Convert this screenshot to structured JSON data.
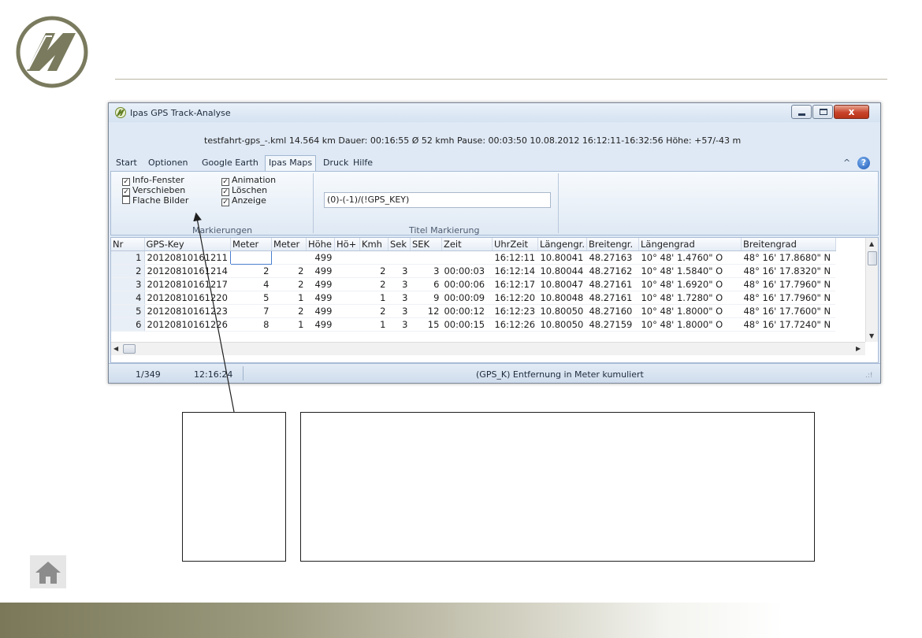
{
  "window": {
    "title": "Ipas GPS Track-Analyse",
    "close_label": "x"
  },
  "info_line": "testfahrt-gps_-.kml 14.564 km  Dauer: 00:16:55  Ø 52 kmh  Pause: 00:03:50  10.08.2012 16:12:11-16:32:56   Höhe: +57/-43 m",
  "ribbon_tabs": [
    "Start",
    "Optionen",
    "Google Earth",
    "Ipas Maps",
    "Druck",
    "Hilfe"
  ],
  "help_label": "?",
  "collapse_label": "^",
  "markierungen": {
    "group_label": "Markierungen",
    "checkboxes": [
      {
        "label": "Info-Fenster",
        "checked": true
      },
      {
        "label": "Verschieben",
        "checked": true
      },
      {
        "label": "Flache Bilder",
        "checked": false
      },
      {
        "label": "Animation",
        "checked": true
      },
      {
        "label": "Löschen",
        "checked": true
      },
      {
        "label": "Anzeige",
        "checked": true
      }
    ]
  },
  "titel_markierung": {
    "group_label": "Titel Markierung",
    "value": "(0)-(-1)/(!GPS_KEY)"
  },
  "grid": {
    "columns": [
      "Nr",
      "GPS-Key",
      "Meter",
      "Meter",
      "Höhe",
      "Hö+",
      "Kmh",
      "Sek",
      "SEK",
      "Zeit",
      "UhrZeit",
      "Längengr.",
      "Breitengr.",
      "Längengrad",
      "Breitengrad"
    ],
    "rows": [
      [
        "1",
        "20120810161211",
        "",
        "",
        "499",
        "",
        "",
        "",
        "",
        "",
        "16:12:11",
        "10.80041",
        "48.27163",
        "10° 48' 1.4760\" O",
        "48° 16' 17.8680\" N"
      ],
      [
        "2",
        "20120810161214",
        "2",
        "2",
        "499",
        "",
        "2",
        "3",
        "3",
        "00:00:03",
        "16:12:14",
        "10.80044",
        "48.27162",
        "10° 48' 1.5840\" O",
        "48° 16' 17.8320\" N"
      ],
      [
        "3",
        "20120810161217",
        "4",
        "2",
        "499",
        "",
        "2",
        "3",
        "6",
        "00:00:06",
        "16:12:17",
        "10.80047",
        "48.27161",
        "10° 48' 1.6920\" O",
        "48° 16' 17.7960\" N"
      ],
      [
        "4",
        "20120810161220",
        "5",
        "1",
        "499",
        "",
        "1",
        "3",
        "9",
        "00:00:09",
        "16:12:20",
        "10.80048",
        "48.27161",
        "10° 48' 1.7280\" O",
        "48° 16' 17.7960\" N"
      ],
      [
        "5",
        "20120810161223",
        "7",
        "2",
        "499",
        "",
        "2",
        "3",
        "12",
        "00:00:12",
        "16:12:23",
        "10.80050",
        "48.27160",
        "10° 48' 1.8000\" O",
        "48° 16' 17.7600\" N"
      ],
      [
        "6",
        "20120810161226",
        "8",
        "1",
        "499",
        "",
        "1",
        "3",
        "15",
        "00:00:15",
        "16:12:26",
        "10.80050",
        "48.27159",
        "10° 48' 1.8000\" O",
        "48° 16' 17.7240\" N"
      ]
    ]
  },
  "status": {
    "position": "1/349",
    "time": "12:16:24",
    "description": "(GPS_K)  Entfernung in Meter kumuliert"
  },
  "colors": {
    "accent": "#1a56b8",
    "logo": "#7a7a5e",
    "footer": "#7a7858"
  }
}
